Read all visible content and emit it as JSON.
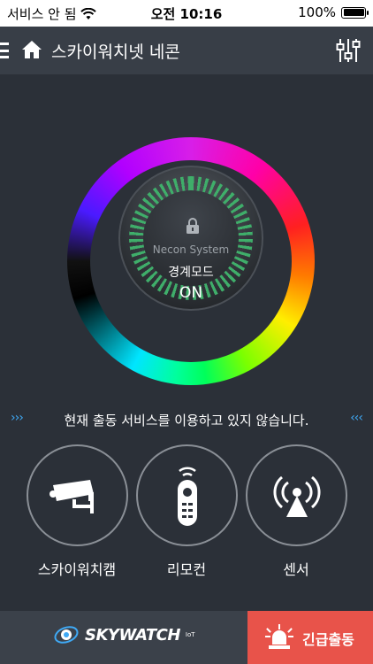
{
  "status_bar": {
    "carrier": "서비스 안 됨",
    "time": "오전 10:16",
    "battery": "100%",
    "battery_level": 1.0
  },
  "header": {
    "title": "스카이워치넷 네콘",
    "menu_icon": "hamburger-icon",
    "home_icon": "home-icon",
    "settings_icon": "sliders-icon"
  },
  "dial": {
    "system_name": "Necon System",
    "mode": "경계모드",
    "state": "ON",
    "lock_icon": "lock-icon"
  },
  "notice": {
    "left_chevrons": "›››",
    "text": "현재 출동 서비스를 이용하고 있지 않습니다.",
    "right_chevrons": "‹‹‹"
  },
  "actions": [
    {
      "label": "스카이워치캠",
      "icon": "cctv-camera-icon"
    },
    {
      "label": "리모컨",
      "icon": "remote-control-icon"
    },
    {
      "label": "센서",
      "icon": "sensor-signal-icon"
    }
  ],
  "bottom": {
    "logo_text": "SKYWATCH",
    "logo_sup": "IoT",
    "emergency_label": "긴급출동",
    "emergency_icon": "siren-icon"
  },
  "colors": {
    "background": "#2b3038",
    "header": "#383e47",
    "accent_blue": "#3fa9f5",
    "emergency_red": "#e8534a",
    "tick_green": "#3fae6a"
  }
}
